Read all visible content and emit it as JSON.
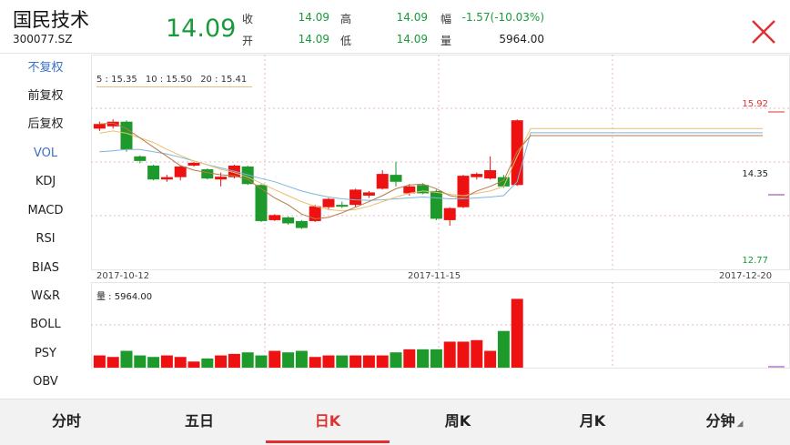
{
  "stock": {
    "name": "国民技术",
    "code": "300077.SZ",
    "price": "14.09"
  },
  "quote": {
    "close_label": "收",
    "close_value": "14.09",
    "high_label": "高",
    "high_value": "14.09",
    "change_label": "幅",
    "change_value": "-1.57(-10.03%)",
    "open_label": "开",
    "open_value": "14.09",
    "low_label": "低",
    "low_value": "14.09",
    "volume_label": "量",
    "volume_value": "5964.00"
  },
  "sidebar": {
    "items": [
      {
        "label": "不复权",
        "active": true
      },
      {
        "label": "前复权",
        "active": false
      },
      {
        "label": "后复权",
        "active": false
      },
      {
        "label": "VOL",
        "active": true
      },
      {
        "label": "KDJ",
        "active": false
      },
      {
        "label": "MACD",
        "active": false
      },
      {
        "label": "RSI",
        "active": false
      },
      {
        "label": "BIAS",
        "active": false
      },
      {
        "label": "W&R",
        "active": false
      },
      {
        "label": "BOLL",
        "active": false
      },
      {
        "label": "PSY",
        "active": false
      },
      {
        "label": "OBV",
        "active": false
      }
    ]
  },
  "chart": {
    "ma5": "5 : 15.35",
    "ma10": "10 : 15.50",
    "ma20": "20 : 15.41",
    "price_max": "15.92",
    "price_mid": "14.35",
    "price_min": "12.77",
    "date_start": "2017-10-12",
    "date_mid": "2017-11-15",
    "date_end": "2017-12-20",
    "volume_label": "量 : 5964.00"
  },
  "tabs": [
    {
      "label": "分时",
      "active": false
    },
    {
      "label": "五日",
      "active": false
    },
    {
      "label": "日K",
      "active": true
    },
    {
      "label": "周K",
      "active": false
    },
    {
      "label": "月K",
      "active": false
    },
    {
      "label": "分钟",
      "active": false
    }
  ],
  "colors": {
    "up": "#ee1111",
    "down": "#1d9a2b",
    "ma5": "#b87a45",
    "ma10": "#e8c070",
    "ma20": "#7fb4dc",
    "accent": "#e23030"
  },
  "chart_data": {
    "type": "candlestick",
    "ylim": [
      12.77,
      15.92
    ],
    "candles": [
      {
        "o": 15.5,
        "c": 15.6,
        "h": 15.65,
        "l": 15.45
      },
      {
        "o": 15.55,
        "c": 15.65,
        "h": 15.7,
        "l": 15.5
      },
      {
        "o": 15.65,
        "c": 15.05,
        "h": 15.68,
        "l": 15.0
      },
      {
        "o": 14.9,
        "c": 14.8,
        "h": 14.92,
        "l": 14.75
      },
      {
        "o": 14.7,
        "c": 14.4,
        "h": 14.72,
        "l": 14.38
      },
      {
        "o": 14.4,
        "c": 14.45,
        "h": 14.5,
        "l": 14.35
      },
      {
        "o": 14.45,
        "c": 14.68,
        "h": 14.7,
        "l": 14.38
      },
      {
        "o": 14.7,
        "c": 14.76,
        "h": 14.78,
        "l": 14.68
      },
      {
        "o": 14.62,
        "c": 14.42,
        "h": 14.64,
        "l": 14.4
      },
      {
        "o": 14.4,
        "c": 14.46,
        "h": 14.55,
        "l": 14.25
      },
      {
        "o": 14.45,
        "c": 14.7,
        "h": 14.72,
        "l": 14.42
      },
      {
        "o": 14.68,
        "c": 14.3,
        "h": 14.7,
        "l": 14.28
      },
      {
        "o": 14.28,
        "c": 13.5,
        "h": 14.3,
        "l": 13.48
      },
      {
        "o": 13.52,
        "c": 13.63,
        "h": 13.65,
        "l": 13.5
      },
      {
        "o": 13.58,
        "c": 13.45,
        "h": 13.6,
        "l": 13.42
      },
      {
        "o": 13.5,
        "c": 13.35,
        "h": 13.52,
        "l": 13.33
      },
      {
        "o": 13.5,
        "c": 13.82,
        "h": 13.85,
        "l": 13.48
      },
      {
        "o": 13.8,
        "c": 13.98,
        "h": 14.0,
        "l": 13.75
      },
      {
        "o": 13.85,
        "c": 13.83,
        "h": 13.92,
        "l": 13.78
      },
      {
        "o": 13.85,
        "c": 14.18,
        "h": 14.2,
        "l": 13.8
      },
      {
        "o": 14.05,
        "c": 14.12,
        "h": 14.15,
        "l": 14.0
      },
      {
        "o": 14.2,
        "c": 14.52,
        "h": 14.6,
        "l": 14.18
      },
      {
        "o": 14.5,
        "c": 14.35,
        "h": 14.78,
        "l": 14.25
      },
      {
        "o": 14.1,
        "c": 14.25,
        "h": 14.3,
        "l": 14.05
      },
      {
        "o": 14.28,
        "c": 14.1,
        "h": 14.32,
        "l": 14.08
      },
      {
        "o": 14.15,
        "c": 13.55,
        "h": 14.18,
        "l": 13.52
      },
      {
        "o": 13.52,
        "c": 13.78,
        "h": 13.8,
        "l": 13.4
      },
      {
        "o": 13.8,
        "c": 14.48,
        "h": 14.5,
        "l": 13.78
      },
      {
        "o": 14.45,
        "c": 14.52,
        "h": 14.55,
        "l": 14.4
      },
      {
        "o": 14.42,
        "c": 14.6,
        "h": 14.9,
        "l": 14.4
      },
      {
        "o": 14.45,
        "c": 14.25,
        "h": 14.5,
        "l": 14.22
      },
      {
        "o": 14.28,
        "c": 15.68,
        "h": 15.7,
        "l": 14.26
      }
    ],
    "volumes": [
      8,
      7,
      11,
      8,
      7,
      8,
      7,
      4,
      6,
      8,
      9,
      10,
      8,
      11,
      10,
      11,
      7,
      8,
      8,
      8,
      8,
      8,
      10,
      12,
      12,
      12,
      17,
      17,
      18,
      11,
      24,
      45,
      47,
      8
    ],
    "ma5": [
      15.6,
      15.62,
      15.5,
      15.3,
      15.1,
      14.9,
      14.7,
      14.6,
      14.55,
      14.5,
      14.48,
      14.4,
      14.2,
      14.0,
      13.85,
      13.65,
      13.55,
      13.58,
      13.68,
      13.8,
      13.92,
      14.05,
      14.2,
      14.28,
      14.3,
      14.2,
      14.05,
      14.0,
      14.15,
      14.25,
      14.38,
      15.0,
      15.35
    ],
    "ma10": [
      15.4,
      15.45,
      15.4,
      15.3,
      15.2,
      15.05,
      14.92,
      14.8,
      14.72,
      14.62,
      14.55,
      14.45,
      14.32,
      14.18,
      14.05,
      13.92,
      13.82,
      13.75,
      13.72,
      13.75,
      13.82,
      13.92,
      14.02,
      14.1,
      14.15,
      14.12,
      14.08,
      14.05,
      14.1,
      14.15,
      14.25,
      14.9,
      15.5
    ],
    "ma20": [
      15.0,
      15.02,
      15.05,
      15.05,
      15.0,
      14.95,
      14.88,
      14.8,
      14.72,
      14.65,
      14.58,
      14.5,
      14.42,
      14.35,
      14.25,
      14.15,
      14.08,
      14.02,
      13.98,
      13.96,
      13.95,
      13.96,
      13.98,
      14.0,
      14.02,
      14.0,
      13.98,
      13.98,
      14.0,
      14.02,
      14.05,
      14.35,
      15.41
    ]
  }
}
